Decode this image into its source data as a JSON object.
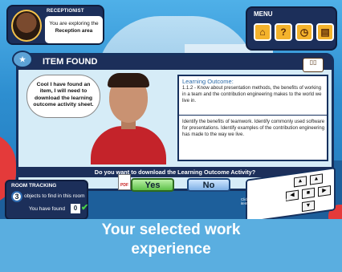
{
  "receptionist": {
    "title": "RECEPTIONIST",
    "line1": "You are exploring the",
    "line2": "Reception area"
  },
  "menu": {
    "title": "MENU",
    "buttons": [
      {
        "icon": "building-icon",
        "glyph": "⌂"
      },
      {
        "icon": "help-icon",
        "glyph": "?"
      },
      {
        "icon": "clock-icon",
        "glyph": "◷"
      },
      {
        "icon": "notepad-icon",
        "glyph": "▤"
      }
    ]
  },
  "dialog": {
    "title": "ITEM FOUND",
    "speech": "Cool I have found an item, I will need to download the learning outcome activity sheet.",
    "learning_outcome_title": "Learning Outcome:",
    "learning_outcome_text": "1.1.2 - Know about presentation methods, the benefits of working in a team and the contribution engineering makes to the world we live in.",
    "description": "Identify the benefits of teamwork. Identify commonly used software for presentations. Identify examples of the contribution engineering has made to the way we live.",
    "question": "Do you want to download the Learning Outcome Activity?",
    "yes_label": "Yes",
    "no_label": "No",
    "pdf_label": "PDF"
  },
  "room_tracking": {
    "title": "ROOM TRACKING",
    "objects_count": "3",
    "objects_text": "objects to find in this room",
    "found_text": "You have found",
    "found_count": "0"
  },
  "keypad": {
    "hint": "Click on this when you find an item"
  },
  "caption": {
    "line1": "Your  selected work",
    "line2": "experience"
  },
  "colors": {
    "panel": "#1c2f5a",
    "accent_red": "#e43a3a",
    "caption_bg": "#5aaee0"
  }
}
